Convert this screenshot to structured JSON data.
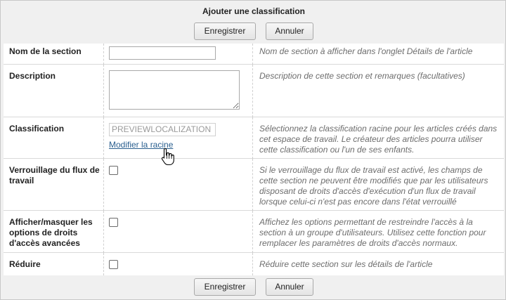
{
  "dialog": {
    "title": "Ajouter une classification",
    "save_label": "Enregistrer",
    "cancel_label": "Annuler"
  },
  "rows": {
    "section_name": {
      "label": "Nom de la section",
      "value": "",
      "help": "Nom de section à afficher dans l'onglet Détails de l'article"
    },
    "description": {
      "label": "Description",
      "value": "",
      "help": "Description de cette section et remarques (facultatives)"
    },
    "classification": {
      "label": "Classification",
      "value": "PREVIEWLOCALIZATION",
      "link": "Modifier la racine",
      "help": "Sélectionnez la classification racine pour les articles créés dans cet espace de travail. Le créateur des articles pourra utiliser cette classification ou l'un de ses enfants."
    },
    "workflow_lock": {
      "label": "Verrouillage du flux de travail",
      "checked": false,
      "help": "Si le verrouillage du flux de travail est activé, les champs de cette section ne peuvent être modifiés que par les utilisateurs disposant de droits d'accès d'exécution d'un flux de travail lorsque celui-ci n'est pas encore dans l'état verrouillé"
    },
    "advanced_access": {
      "label": "Afficher/masquer les options de droits d'accès avancées",
      "checked": false,
      "help": "Affichez les options permettant de restreindre l'accès à la section à un groupe d'utilisateurs. Utilisez cette fonction pour remplacer les paramètres de droits d'accès normaux."
    },
    "collapse": {
      "label": "Réduire",
      "checked": false,
      "help": "Réduire cette section sur les détails de l'article"
    }
  },
  "icons": {
    "cursor": "hand-pointer-icon"
  }
}
